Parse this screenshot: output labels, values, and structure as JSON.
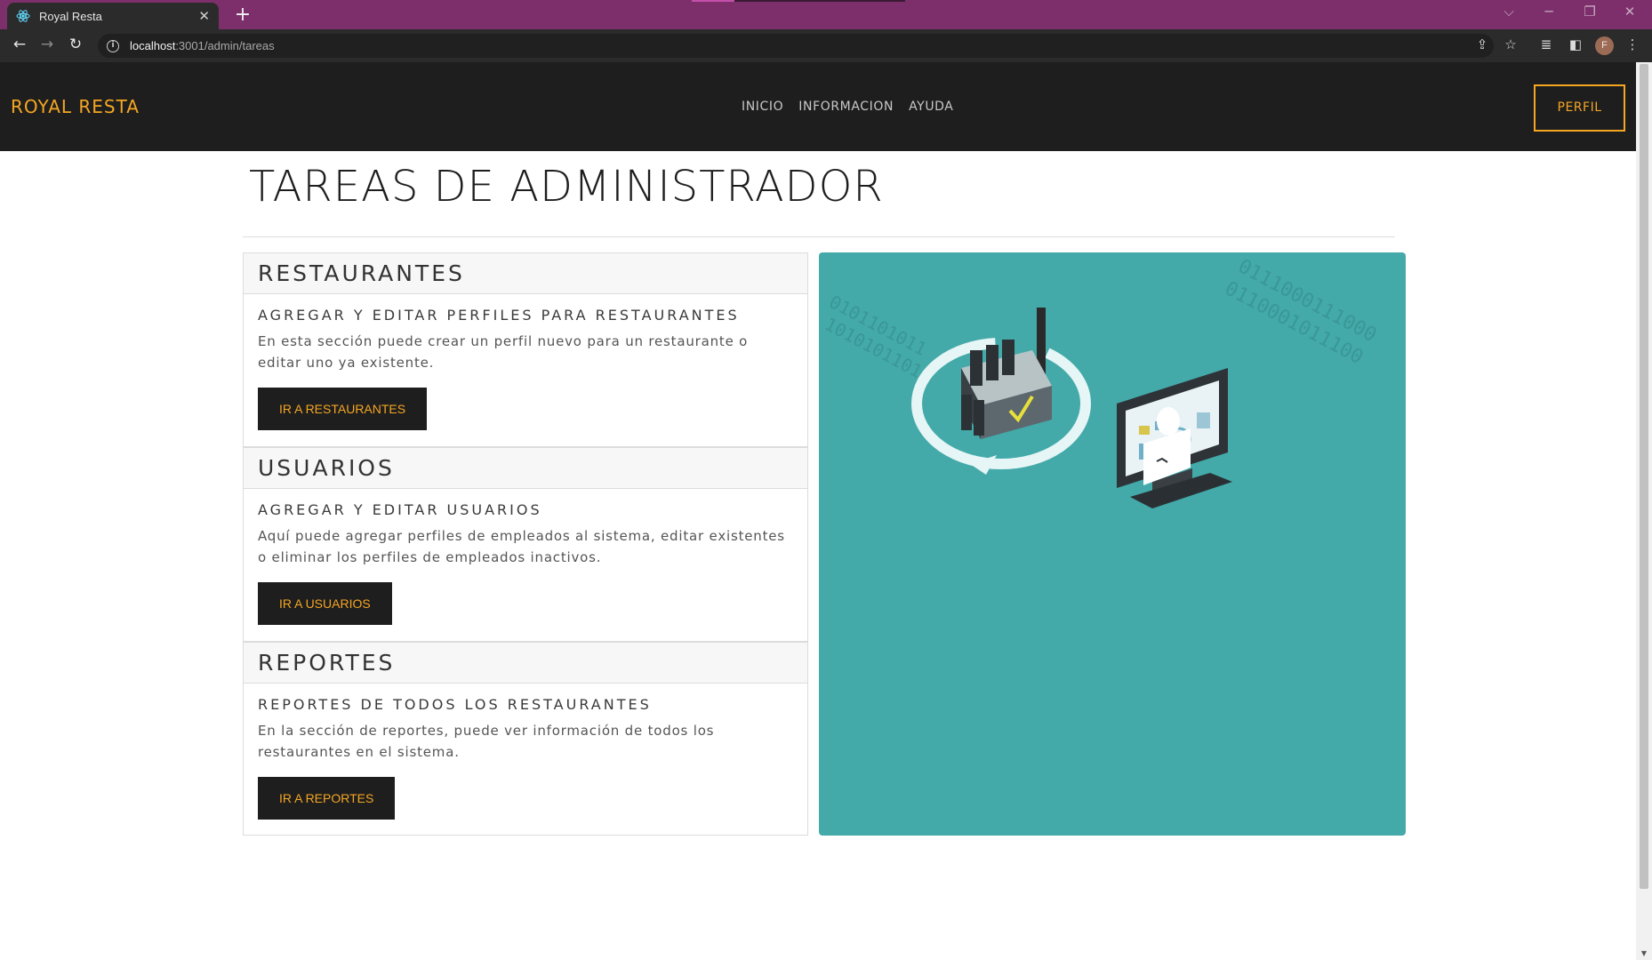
{
  "browser": {
    "tab_title": "Royal Resta",
    "new_tab": "+",
    "url_host": "localhost",
    "url_path": ":3001/admin/tareas",
    "profile_initial": "F"
  },
  "site": {
    "brand": "ROYAL RESTA",
    "nav": [
      "INICIO",
      "INFORMACION",
      "AYUDA"
    ],
    "profile_button": "PERFIL"
  },
  "page": {
    "title": "TAREAS DE ADMINISTRADOR"
  },
  "sections": [
    {
      "header": "RESTAURANTES",
      "subtitle": "AGREGAR Y EDITAR PERFILES PARA RESTAURANTES",
      "text": "En esta sección puede crear un perfil nuevo para un restaurante o editar uno ya existente.",
      "button": "IR A RESTAURANTES"
    },
    {
      "header": "USUARIOS",
      "subtitle": "AGREGAR Y EDITAR USUARIOS",
      "text": "Aquí puede agregar perfiles de empleados al sistema, editar existentes o eliminar los perfiles de empleados inactivos.",
      "button": "IR A USUARIOS"
    },
    {
      "header": "REPORTES",
      "subtitle": "REPORTES DE TODOS LOS RESTAURANTES",
      "text": "En la sección de reportes, puede ver información de todos los restaurantes en el sistema.",
      "button": "IR A REPORTES"
    }
  ],
  "illustration": {
    "binary_top": "0111000111000",
    "binary_top2": "0110001011100",
    "binary_left": "0101101011",
    "binary_left2": "1010101101"
  },
  "colors": {
    "accent": "#f5a623",
    "nav_bg": "#1e1e1e",
    "illustration_bg": "#43a9a9",
    "tab_strip": "#7c2f6b"
  }
}
